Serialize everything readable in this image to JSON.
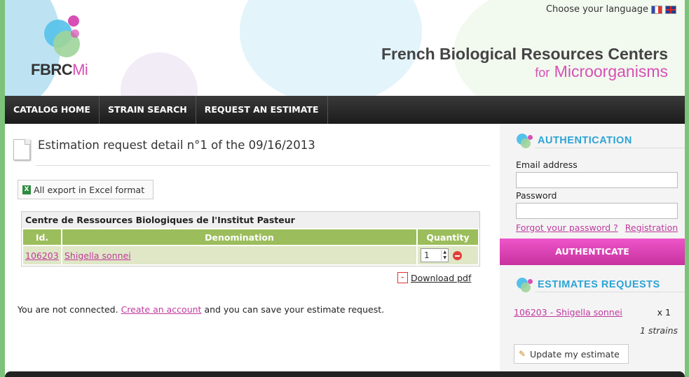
{
  "header": {
    "logo_main": "FBRC",
    "logo_accent": "Mi",
    "language_label": "Choose your language",
    "title_line1": "French Biological Resources Centers",
    "title_for": "for",
    "title_line2": "Microorganisms"
  },
  "nav": {
    "items": [
      {
        "label": "CATALOG HOME"
      },
      {
        "label": "STRAIN SEARCH"
      },
      {
        "label": "REQUEST AN ESTIMATE"
      }
    ]
  },
  "main": {
    "page_title": "Estimation request detail n°1 of the 09/16/2013",
    "excel_button": "All export in Excel format",
    "center_name": "Centre de Ressources Biologiques de l'Institut Pasteur",
    "table": {
      "headers": [
        "Id.",
        "Denomination",
        "Quantity"
      ],
      "rows": [
        {
          "id": "106203",
          "denomination": "Shigella sonnei",
          "quantity": "1"
        }
      ]
    },
    "download_pdf": "Download pdf",
    "notice_before": "You are not connected.",
    "notice_link": "Create an account",
    "notice_after": "and you can save your estimate request."
  },
  "sidebar": {
    "auth_title": "AUTHENTICATION",
    "email_label": "Email address",
    "password_label": "Password",
    "forgot_link": "Forgot your password ?",
    "registration_link": "Registration",
    "auth_button": "AUTHENTICATE",
    "estimates_title": "ESTIMATES REQUESTS",
    "estimate_item": "106203 - Shigella sonnei",
    "estimate_count": "x 1",
    "strains_total": "1 strains",
    "update_button": "Update my estimate"
  },
  "colors": {
    "accent_pink": "#d74fb5",
    "accent_blue": "#2ca3d6",
    "table_header_green": "#9bbd5b",
    "page_background_green": "#7dc27a"
  },
  "icons": [
    "document-icon",
    "excel-icon",
    "pdf-icon",
    "remove-icon",
    "pencil-icon",
    "flag-fr-icon",
    "flag-uk-icon",
    "bubbles-icon"
  ]
}
